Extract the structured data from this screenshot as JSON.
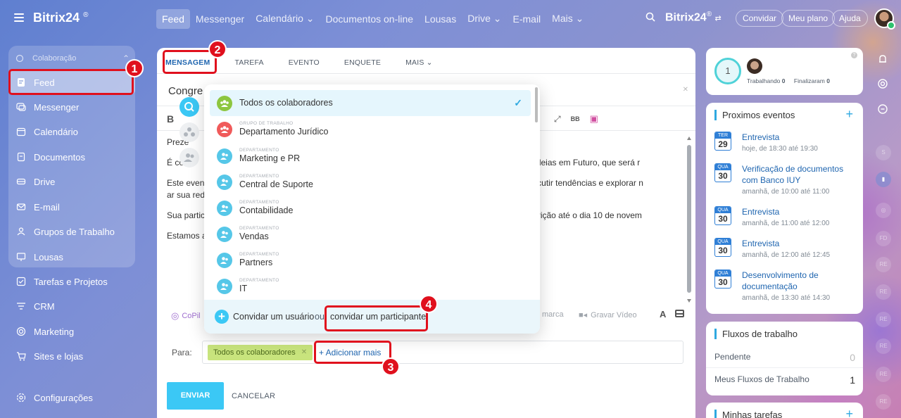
{
  "app": {
    "logo": "Bitrix24",
    "logo_mark": "®",
    "logo_right": "Bitrix24",
    "logo_right_mark": "®"
  },
  "topnav": {
    "items": [
      "Feed",
      "Messenger",
      "Calendário ⌄",
      "Documentos on-line",
      "Lousas",
      "Drive ⌄",
      "E-mail",
      "Mais ⌄"
    ],
    "invite": "Convidar",
    "plan": "Meu plano",
    "help": "Ajuda"
  },
  "sidebar": {
    "section": "Colaboração",
    "items": [
      {
        "label": "Feed",
        "icon": "feed-icon"
      },
      {
        "label": "Messenger",
        "icon": "chat-icon"
      },
      {
        "label": "Calendário",
        "icon": "calendar-icon"
      },
      {
        "label": "Documentos",
        "icon": "document-icon"
      },
      {
        "label": "Drive",
        "icon": "drive-icon"
      },
      {
        "label": "E-mail",
        "icon": "mail-icon"
      },
      {
        "label": "Grupos de Trabalho",
        "icon": "groups-icon"
      },
      {
        "label": "Lousas",
        "icon": "board-icon"
      }
    ],
    "extra": [
      {
        "label": "Tarefas e Projetos",
        "icon": "tasks-icon"
      },
      {
        "label": "CRM",
        "icon": "crm-icon"
      },
      {
        "label": "Marketing",
        "icon": "marketing-icon"
      },
      {
        "label": "Sites e lojas",
        "icon": "cart-icon"
      }
    ],
    "settings": "Configurações"
  },
  "composer": {
    "tabs": [
      "MENSAGEM",
      "TAREFA",
      "EVENTO",
      "ENQUETE",
      "MAIS ⌄"
    ],
    "title": "Congre",
    "bold": "B",
    "body": [
      "Preze",
      "É co                                                                                                                    025: Transformando Ideias em Futuro, que será r",
      "Este event                                                                                                              conhecimentos, discutir tendências e explorar n                                                                                                  ar sua rede de contatos, adquirir insights va",
      "Sua partic                                                                                                              que realize sua inscrição até o dia 10 de novem",
      "Estamos a"
    ],
    "copilot": "CoPil",
    "marca": "marca",
    "video": "Gravar Vídeo",
    "font_tool": "A",
    "to_label": "Para:",
    "recipient_chip": "Todos os colaboradores",
    "add_more": "+ Adicionar mais",
    "send": "ENVIAR",
    "cancel": "CANCELAR"
  },
  "dropdown": {
    "items": [
      {
        "category": "",
        "name": "Todos os colaboradores",
        "color": "#8dc63f",
        "selected": true
      },
      {
        "category": "GRUPO DE TRABALHO",
        "name": "Departamento Jurídico",
        "color": "#f05a5a"
      },
      {
        "category": "DEPARTAMENTO",
        "name": "Marketing e PR",
        "color": "#56c7e8"
      },
      {
        "category": "DEPARTAMENTO",
        "name": "Central de Suporte",
        "color": "#56c7e8"
      },
      {
        "category": "DEPARTAMENTO",
        "name": "Contabilidade",
        "color": "#56c7e8"
      },
      {
        "category": "DEPARTAMENTO",
        "name": "Vendas",
        "color": "#56c7e8"
      },
      {
        "category": "DEPARTAMENTO",
        "name": "Partners",
        "color": "#56c7e8"
      },
      {
        "category": "DEPARTAMENTO",
        "name": "IT",
        "color": "#56c7e8"
      }
    ],
    "invite_user": "Convidar um usuário",
    "or": "ou",
    "invite_participant": "convidar um participante"
  },
  "annotations": [
    "1",
    "2",
    "3",
    "4"
  ],
  "right": {
    "timer_value": "1",
    "working_label": "Trabalhando",
    "working_count": "0",
    "finished_label": "Finalizaram",
    "finished_count": "0",
    "events_title": "Proximos eventos",
    "events": [
      {
        "month": "TER",
        "day": "29",
        "title": "Entrevista",
        "time": "hoje, de 18:30 até 19:30"
      },
      {
        "month": "QUA",
        "day": "30",
        "title": "Verificação de documentos com Banco IUY",
        "time": "amanhã, de 10:00 até 11:00"
      },
      {
        "month": "QUA",
        "day": "30",
        "title": "Entrevista",
        "time": "amanhã, de 11:00 até 12:00"
      },
      {
        "month": "QUA",
        "day": "30",
        "title": "Entrevista",
        "time": "amanhã, de 12:00 até 12:45"
      },
      {
        "month": "QUA",
        "day": "30",
        "title": "Desenvolvimento de documentação",
        "time": "amanhã, de 13:30 até 14:30"
      }
    ],
    "flows_title": "Fluxos de trabalho",
    "pending_label": "Pendente",
    "pending_value": "0",
    "myflows_label": "Meus Fluxos de Trabalho",
    "myflows_value": "1",
    "tasks_title": "Minhas tarefas"
  },
  "rail": [
    "S",
    "FD",
    "RE",
    "RE",
    "RE",
    "RE",
    "RE",
    "RE"
  ],
  "colors": {
    "accent": "#2066b0",
    "annotation": "#e0101d",
    "send": "#3bc8f5"
  }
}
